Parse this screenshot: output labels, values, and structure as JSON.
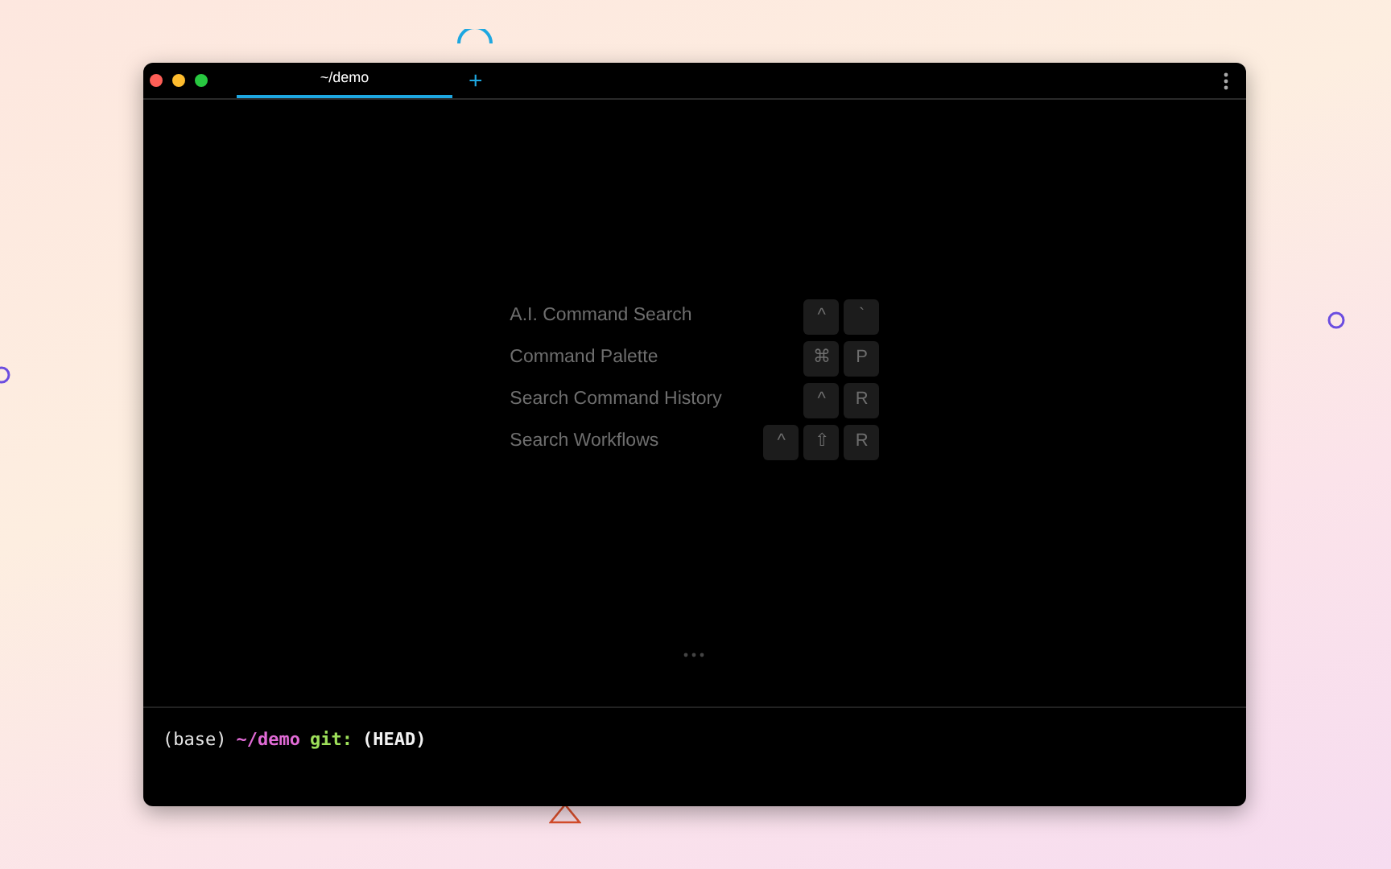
{
  "tabs": [
    {
      "label": "~/demo",
      "selected": true
    }
  ],
  "new_tab": "+",
  "shortcuts": [
    {
      "label": "A.I. Command Search",
      "keys": [
        "^",
        "`"
      ]
    },
    {
      "label": "Command Palette",
      "keys": [
        "⌘",
        "P"
      ]
    },
    {
      "label": "Search Command History",
      "keys": [
        "^",
        "R"
      ]
    },
    {
      "label": "Search Workflows",
      "keys": [
        "^",
        "⇧",
        "R"
      ]
    }
  ],
  "prompt": [
    {
      "kind": "env",
      "text": "(base)"
    },
    {
      "kind": "path",
      "text": "~/demo"
    },
    {
      "kind": "git",
      "text": "git:"
    },
    {
      "kind": "branch",
      "text": "(HEAD)"
    }
  ]
}
